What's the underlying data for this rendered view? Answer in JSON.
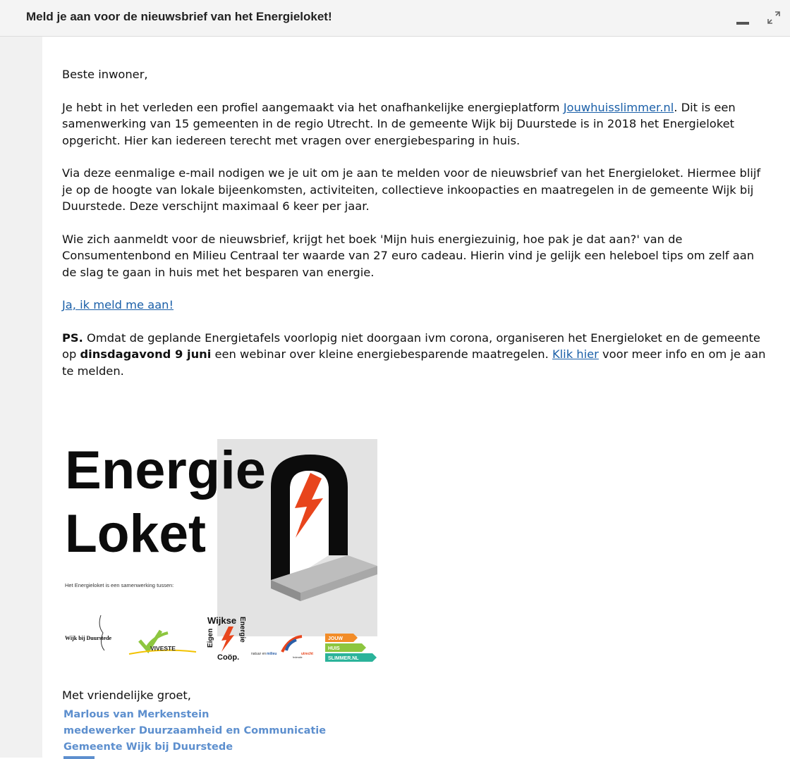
{
  "header": {
    "title": "Meld je aan voor de nieuwsbrief van het Energieloket!"
  },
  "email": {
    "greeting": "Beste inwoner,",
    "p1_before": "Je hebt in het verleden een profiel aangemaakt via het onafhankelijke energieplatform ",
    "p1_link": "Jouwhuisslimmer.nl",
    "p1_after": ". Dit is een samenwerking van 15 gemeenten in de regio Utrecht. In de gemeente Wijk bij Duurstede is in 2018 het Energieloket opgericht. Hier kan iedereen terecht met vragen over energiebesparing in huis.",
    "p2": "Via deze eenmalige e-mail nodigen we je uit om je aan te melden voor de nieuwsbrief van het Energieloket. Hiermee blijf je op de hoogte van lokale bijeenkomsten, activiteiten, collectieve inkoopacties en maatregelen in de gemeente Wijk bij Duurstede. Deze verschijnt maximaal 6 keer per jaar.",
    "p3": "Wie zich aanmeldt voor de nieuwsbrief, krijgt het boek 'Mijn huis energiezuinig, hoe pak je dat aan?' van de Consumentenbond en Milieu Centraal ter waarde van 27 euro cadeau. Hierin vind je gelijk een heleboel tips om zelf aan de slag te gaan in huis met het besparen van energie.",
    "signup_link": "Ja, ik meld me aan!",
    "ps_label": "PS.",
    "ps_text1": " Omdat de geplande Energietafels voorlopig niet doorgaan ivm corona, organiseren het Energieloket en de gemeente op ",
    "ps_bold": "dinsdagavond 9 juni",
    "ps_text2": " een webinar over kleine energiebesparende maatregelen. ",
    "ps_link": "Klik hier",
    "ps_text3": " voor meer info en om je aan te melden.",
    "closing": "Met vriendelijke groet,",
    "sig_name": "Marlous van Merkenstein",
    "sig_role": "medewerker Duurzaamheid en Communicatie",
    "sig_org": "Gemeente Wijk bij Duurstede"
  },
  "logo": {
    "line1": "Energie",
    "line2": "Loket",
    "caption": "Het Energieloket is een samenwerking tussen:",
    "partner_wijk": "Wijk bij Duurstede",
    "partner_viveste": "VIVESTE",
    "partner_coop_word1": "Wijkse",
    "partner_coop_word2": "Eigen",
    "partner_coop_word3": "Energie",
    "partner_coop_word4": "Coöp.",
    "partner_nmu1": "natuur en",
    "partner_nmu2": "milieu",
    "partner_nmu3": "utrecht",
    "partner_nmu4": "federatie",
    "partner_jhs1": "JOUW",
    "partner_jhs2": "HUIS",
    "partner_jhs3": "SLIMMER.NL"
  },
  "colors": {
    "link": "#1a5fa8",
    "signature": "#5d8fce",
    "bolt": "#e8451c",
    "jouw": "#f28c28",
    "huis": "#8dc63f",
    "slimmer": "#2bb39a"
  }
}
